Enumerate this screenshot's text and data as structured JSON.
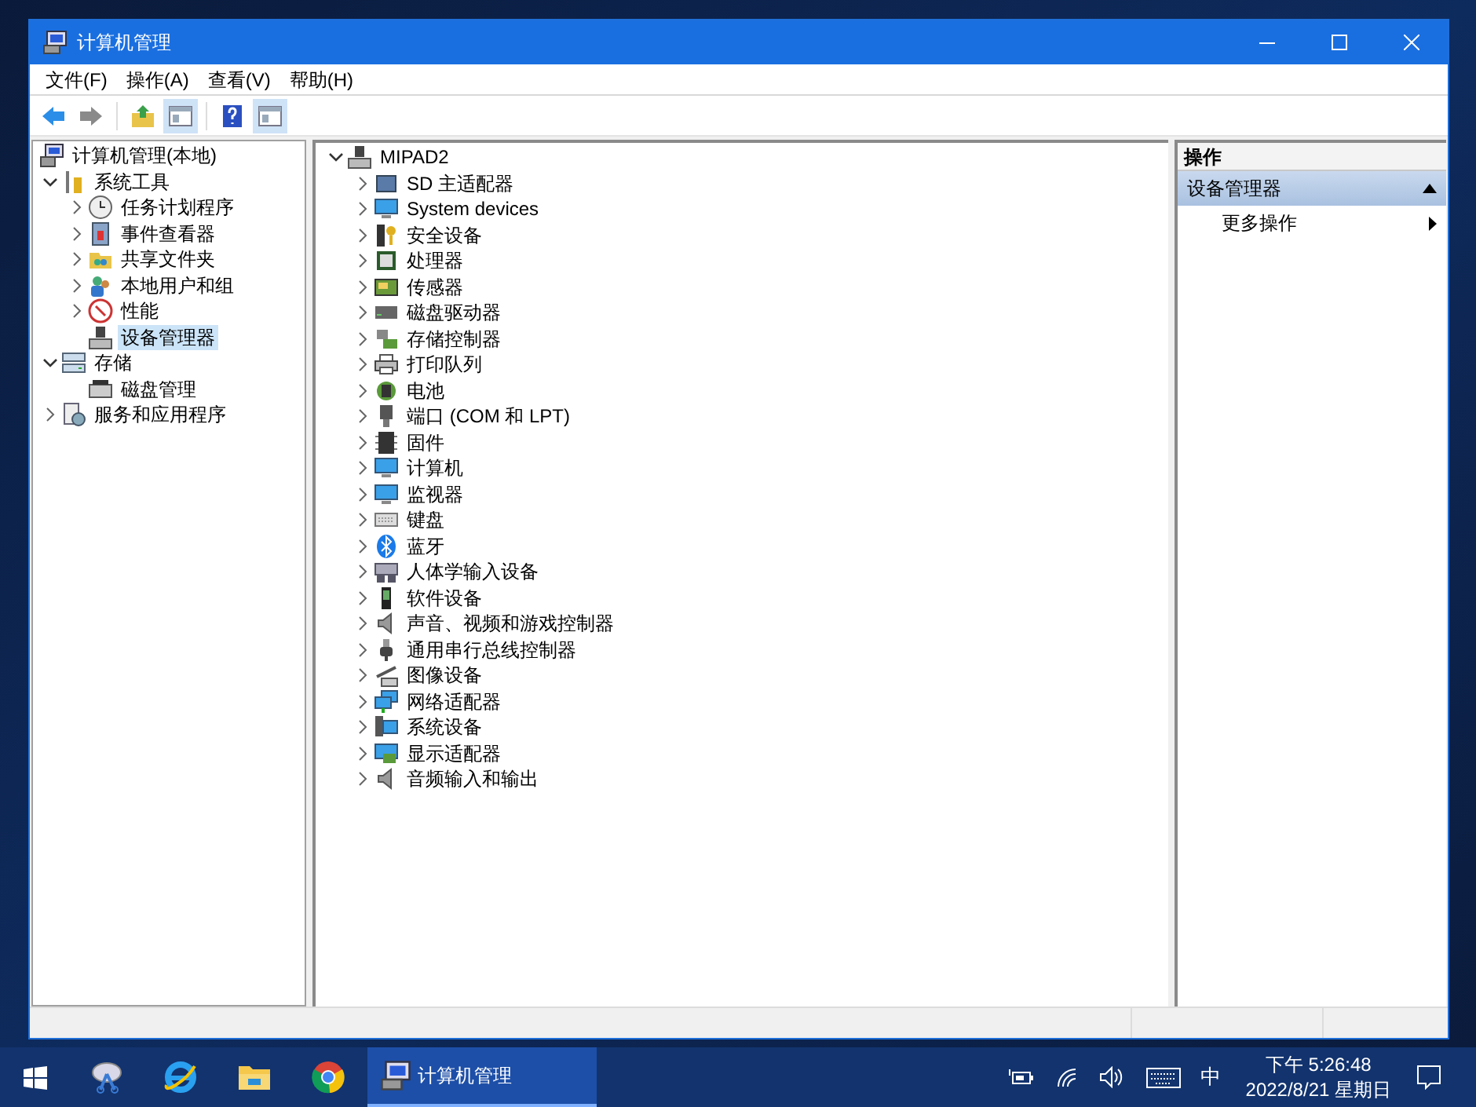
{
  "window": {
    "title": "计算机管理"
  },
  "menu": [
    "文件(F)",
    "操作(A)",
    "查看(V)",
    "帮助(H)"
  ],
  "toolbar": [
    {
      "kind": "back",
      "on": false
    },
    {
      "kind": "forward",
      "on": false
    },
    {
      "kind": "up",
      "on": false
    },
    {
      "kind": "pane",
      "on": true
    },
    {
      "kind": "help",
      "on": false
    },
    {
      "kind": "pane",
      "on": true
    }
  ],
  "nav_tree": {
    "label": "计算机管理(本地)",
    "children": [
      {
        "label": "系统工具",
        "expanded": true,
        "selected": false,
        "children": [
          {
            "label": "任务计划程序",
            "expanded": false,
            "selected": false
          },
          {
            "label": "事件查看器",
            "expanded": false,
            "selected": false
          },
          {
            "label": "共享文件夹",
            "expanded": false,
            "selected": false
          },
          {
            "label": "本地用户和组",
            "expanded": false,
            "selected": false
          },
          {
            "label": "性能",
            "expanded": false,
            "selected": false
          },
          {
            "label": "设备管理器",
            "selected": true
          }
        ]
      },
      {
        "label": "存储",
        "expanded": true,
        "selected": false,
        "children": [
          {
            "label": "磁盘管理",
            "selected": false
          }
        ]
      },
      {
        "label": "服务和应用程序",
        "expanded": false,
        "selected": false
      }
    ]
  },
  "device_tree": {
    "label": "MIPAD2",
    "expanded": true,
    "children": [
      "SD 主适配器",
      "System devices",
      "安全设备",
      "处理器",
      "传感器",
      "磁盘驱动器",
      "存储控制器",
      "打印队列",
      "电池",
      "端口 (COM 和 LPT)",
      "固件",
      "计算机",
      "监视器",
      "键盘",
      "蓝牙",
      "人体学输入设备",
      "软件设备",
      "声音、视频和游戏控制器",
      "通用串行总线控制器",
      "图像设备",
      "网络适配器",
      "系统设备",
      "显示适配器",
      "音频输入和输出"
    ]
  },
  "actions_pane": {
    "header": "操作",
    "section": {
      "label": "设备管理器",
      "expanded": true
    },
    "items": [
      "更多操作"
    ]
  },
  "taskbar": {
    "active_app": "计算机管理",
    "input_method": "中",
    "time": "下午 5:26:48",
    "date": "2022/8/21 星期日"
  }
}
